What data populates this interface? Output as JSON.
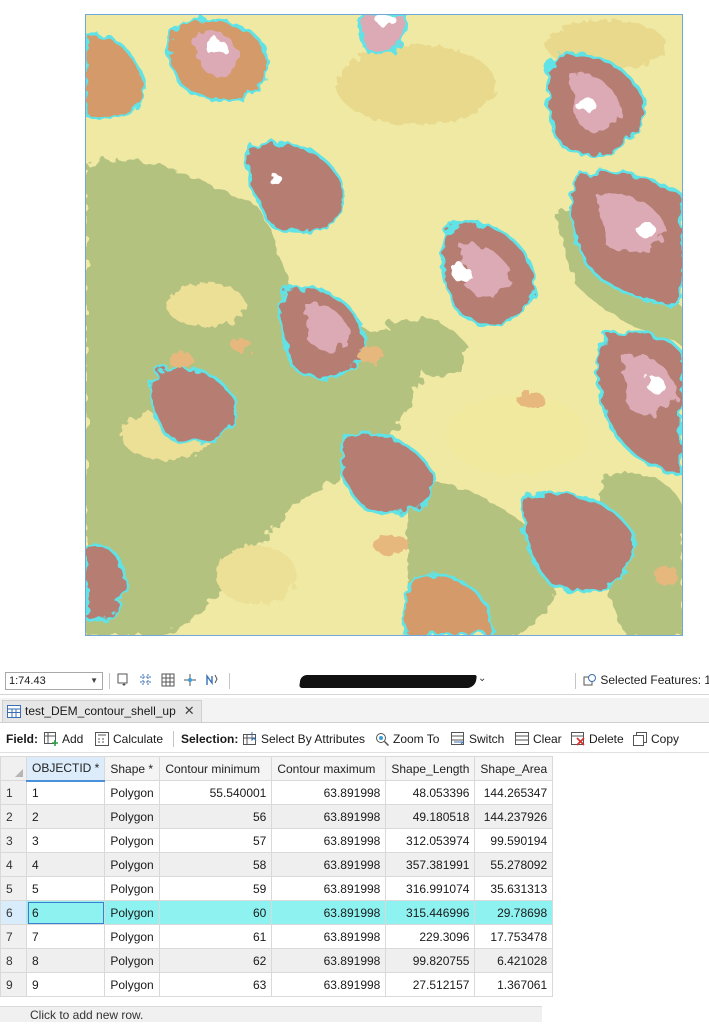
{
  "map": {
    "name": "DEM contour shell map view",
    "colors": {
      "base": "#efe9a3",
      "low_green": "#b4c280",
      "pale_yellow": "#ecdf96",
      "tan": "#e7b87d",
      "orange_brown": "#d49a6a",
      "brown": "#b67d72",
      "pink": "#dcaab4",
      "white": "#ffffff",
      "outline_cyan": "#5fe3e6"
    }
  },
  "status_bar": {
    "scale": "1:74.43",
    "selected_features": "Selected Features: 1"
  },
  "tab": {
    "title": "test_DEM_contour_shell_up"
  },
  "toolbar": {
    "field_label": "Field:",
    "add": "Add",
    "calculate": "Calculate",
    "selection_label": "Selection:",
    "select_by_attributes": "Select By Attributes",
    "zoom_to": "Zoom To",
    "switch": "Switch",
    "clear": "Clear",
    "delete": "Delete",
    "copy": "Copy"
  },
  "table": {
    "columns": [
      "OBJECTID *",
      "Shape *",
      "Contour minimum",
      "Contour maximum",
      "Shape_Length",
      "Shape_Area"
    ],
    "rows": [
      {
        "n": "1",
        "objectid": "1",
        "shape": "Polygon",
        "cmin": "55.540001",
        "cmax": "63.891998",
        "len": "48.053396",
        "area": "144.265347"
      },
      {
        "n": "2",
        "objectid": "2",
        "shape": "Polygon",
        "cmin": "56",
        "cmax": "63.891998",
        "len": "49.180518",
        "area": "144.237926"
      },
      {
        "n": "3",
        "objectid": "3",
        "shape": "Polygon",
        "cmin": "57",
        "cmax": "63.891998",
        "len": "312.053974",
        "area": "99.590194"
      },
      {
        "n": "4",
        "objectid": "4",
        "shape": "Polygon",
        "cmin": "58",
        "cmax": "63.891998",
        "len": "357.381991",
        "area": "55.278092"
      },
      {
        "n": "5",
        "objectid": "5",
        "shape": "Polygon",
        "cmin": "59",
        "cmax": "63.891998",
        "len": "316.991074",
        "area": "35.631313"
      },
      {
        "n": "6",
        "objectid": "6",
        "shape": "Polygon",
        "cmin": "60",
        "cmax": "63.891998",
        "len": "315.446996",
        "area": "29.78698"
      },
      {
        "n": "7",
        "objectid": "7",
        "shape": "Polygon",
        "cmin": "61",
        "cmax": "63.891998",
        "len": "229.3096",
        "area": "17.753478"
      },
      {
        "n": "8",
        "objectid": "8",
        "shape": "Polygon",
        "cmin": "62",
        "cmax": "63.891998",
        "len": "99.820755",
        "area": "6.421028"
      },
      {
        "n": "9",
        "objectid": "9",
        "shape": "Polygon",
        "cmin": "63",
        "cmax": "63.891998",
        "len": "27.512157",
        "area": "1.367061"
      }
    ],
    "selected_row": "6",
    "add_row_hint": "Click to add new row."
  }
}
